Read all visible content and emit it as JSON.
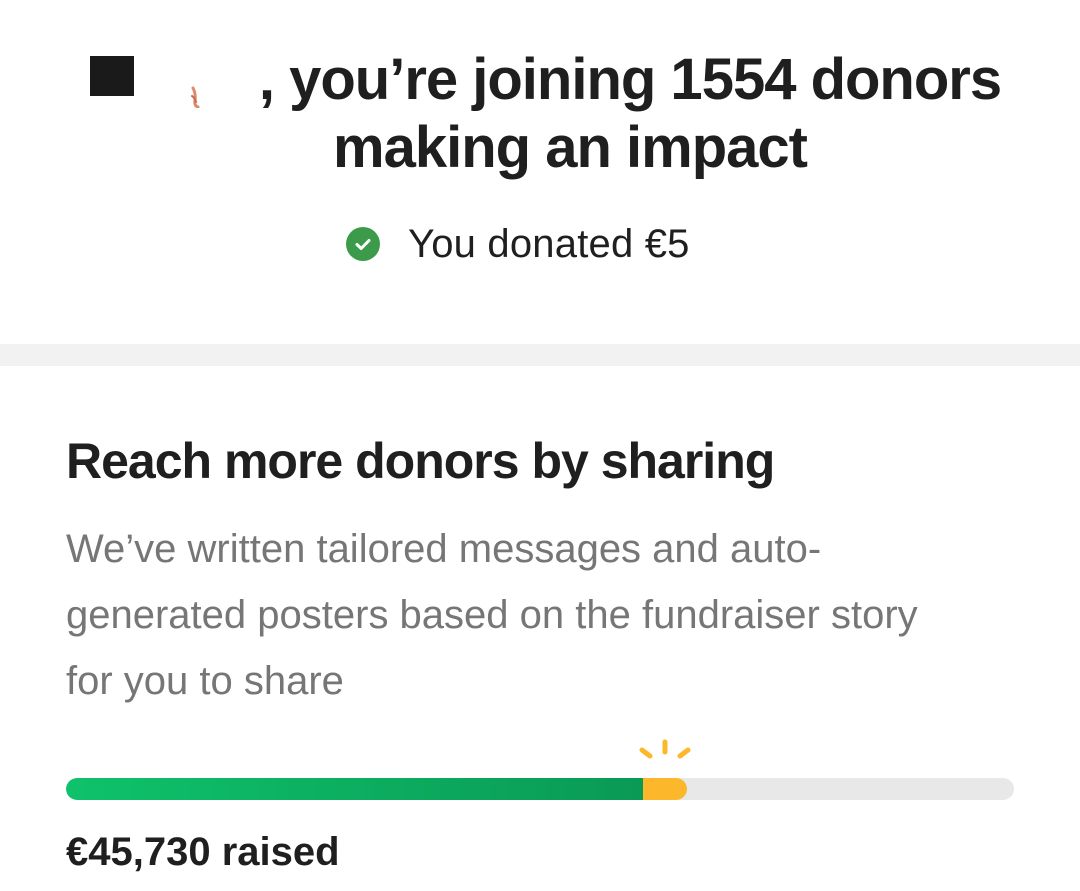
{
  "header": {
    "headline_line1": ", you’re joining 1554 donors",
    "headline_line2": "making an impact",
    "donated_text": "You donated €5"
  },
  "share": {
    "title": "Reach more donors by sharing",
    "description": "We’ve written tailored messages and auto-generated posters based on the fundraiser story for you to share"
  },
  "progress": {
    "raised_label": "€45,730 raised",
    "fraction_raised": 0.609,
    "fraction_with_donation": 0.655
  },
  "colors": {
    "success_green": "#3b9b4a",
    "progress_green": "#0ec26b",
    "progress_highlight": "#fdb72b",
    "track": "#e8e8e8"
  },
  "icons": {
    "check": "check-circle-icon",
    "sparkle": "sparkle-icon"
  }
}
